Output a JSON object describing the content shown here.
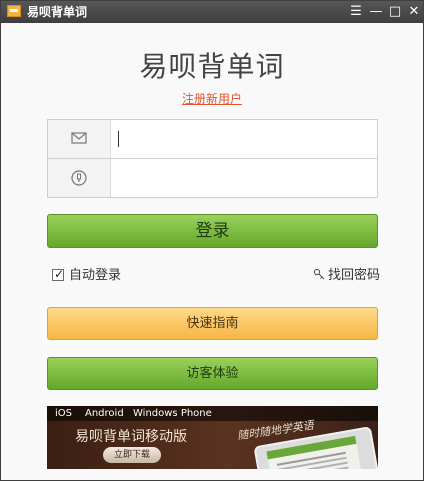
{
  "window": {
    "title": "易呗背单词",
    "controls": {
      "menu_icon": "☰",
      "minimize_icon": "—",
      "maximize_icon": "□",
      "close_icon": "✕"
    }
  },
  "header": {
    "app_name": "易呗背单词",
    "register_link": "注册新用户"
  },
  "login": {
    "email": {
      "value": "",
      "icon": "envelope-icon"
    },
    "password": {
      "value": "",
      "icon": "lock-icon"
    },
    "login_button": "登录",
    "remember": {
      "label": "自动登录",
      "checked": true,
      "mark": "✓"
    },
    "forgot_password": "找回密码"
  },
  "actions": {
    "guide_button": "快速指南",
    "visitor_button": "访客体验"
  },
  "banner": {
    "platforms": [
      "iOS",
      "Android",
      "Windows Phone"
    ],
    "title": "易呗背单词移动版",
    "download_button": "立即下载",
    "slogan": "随时随地学英语"
  },
  "colors": {
    "titlebar": "#474747",
    "green_button": "#7bbd3d",
    "orange_button": "#f6c45f",
    "register_link": "#e0562d"
  }
}
